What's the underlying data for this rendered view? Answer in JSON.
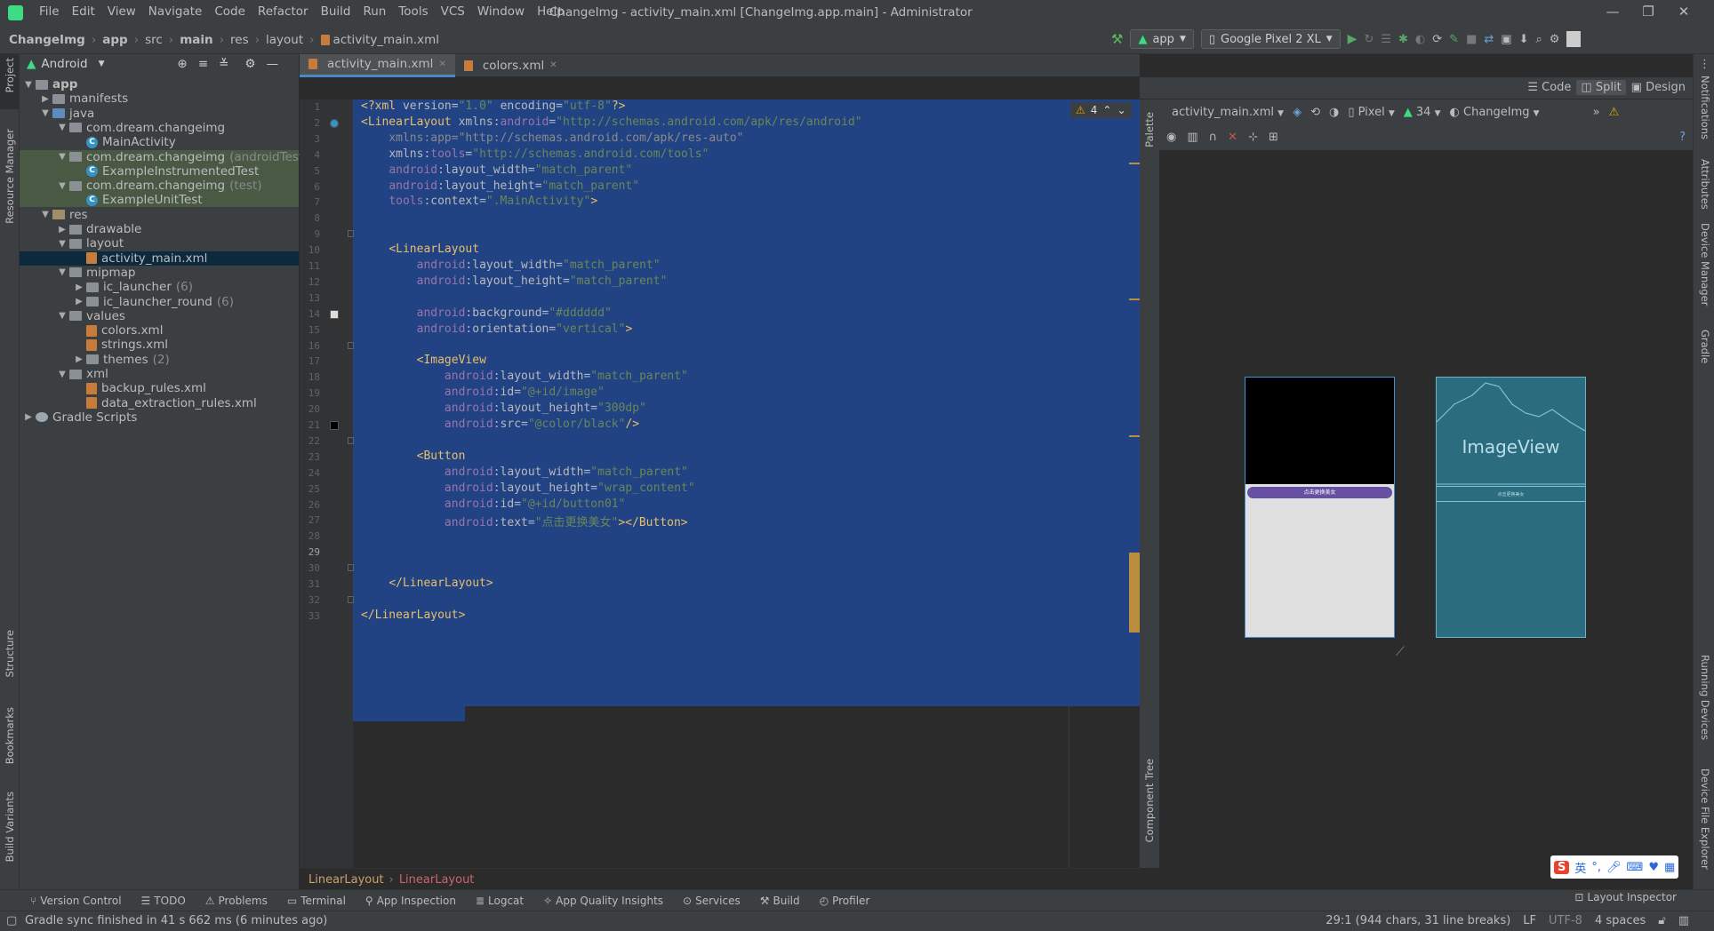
{
  "menu": {
    "items": [
      "File",
      "Edit",
      "View",
      "Navigate",
      "Code",
      "Refactor",
      "Build",
      "Run",
      "Tools",
      "VCS",
      "Window",
      "Help"
    ]
  },
  "window": {
    "title": "ChangeImg - activity_main.xml [ChangeImg.app.main] - Administrator"
  },
  "breadcrumb": {
    "items": [
      "ChangeImg",
      "app",
      "src",
      "main",
      "res",
      "layout",
      "activity_main.xml"
    ]
  },
  "toolbar": {
    "run_config": "app",
    "device": "Google Pixel 2 XL"
  },
  "project": {
    "view_label": "Android",
    "tree": [
      {
        "label": "app",
        "depth": 0,
        "arrow": "▼",
        "icon": "folder",
        "bold": true
      },
      {
        "label": "manifests",
        "depth": 1,
        "arrow": "▶",
        "icon": "folder"
      },
      {
        "label": "java",
        "depth": 1,
        "arrow": "▼",
        "icon": "jfolder"
      },
      {
        "label": "com.dream.changeimg",
        "depth": 2,
        "arrow": "▼",
        "icon": "folder"
      },
      {
        "label": "MainActivity",
        "depth": 3,
        "arrow": "",
        "icon": "class"
      },
      {
        "label": "com.dream.changeimg",
        "suffix": "(androidTest)",
        "depth": 2,
        "arrow": "▼",
        "icon": "folder",
        "hl": true
      },
      {
        "label": "ExampleInstrumentedTest",
        "depth": 3,
        "arrow": "",
        "icon": "class",
        "hl": true
      },
      {
        "label": "com.dream.changeimg",
        "suffix": "(test)",
        "depth": 2,
        "arrow": "▼",
        "icon": "folder",
        "hl": true
      },
      {
        "label": "ExampleUnitTest",
        "depth": 3,
        "arrow": "",
        "icon": "class",
        "hl": true
      },
      {
        "label": "res",
        "depth": 1,
        "arrow": "▼",
        "icon": "rfolder"
      },
      {
        "label": "drawable",
        "depth": 2,
        "arrow": "▶",
        "icon": "folder"
      },
      {
        "label": "layout",
        "depth": 2,
        "arrow": "▼",
        "icon": "folder"
      },
      {
        "label": "activity_main.xml",
        "depth": 3,
        "arrow": "",
        "icon": "xml",
        "selected": true
      },
      {
        "label": "mipmap",
        "depth": 2,
        "arrow": "▼",
        "icon": "folder"
      },
      {
        "label": "ic_launcher",
        "suffix": "(6)",
        "depth": 3,
        "arrow": "▶",
        "icon": "folder"
      },
      {
        "label": "ic_launcher_round",
        "suffix": "(6)",
        "depth": 3,
        "arrow": "▶",
        "icon": "folder"
      },
      {
        "label": "values",
        "depth": 2,
        "arrow": "▼",
        "icon": "folder"
      },
      {
        "label": "colors.xml",
        "depth": 3,
        "arrow": "",
        "icon": "xml"
      },
      {
        "label": "strings.xml",
        "depth": 3,
        "arrow": "",
        "icon": "xml"
      },
      {
        "label": "themes",
        "suffix": "(2)",
        "depth": 3,
        "arrow": "▶",
        "icon": "folder"
      },
      {
        "label": "xml",
        "depth": 2,
        "arrow": "▼",
        "icon": "folder"
      },
      {
        "label": "backup_rules.xml",
        "depth": 3,
        "arrow": "",
        "icon": "xml"
      },
      {
        "label": "data_extraction_rules.xml",
        "depth": 3,
        "arrow": "",
        "icon": "xml"
      },
      {
        "label": "Gradle Scripts",
        "depth": 0,
        "arrow": "▶",
        "icon": "gradle"
      }
    ]
  },
  "tabs": [
    {
      "label": "activity_main.xml",
      "active": true
    },
    {
      "label": "colors.xml",
      "active": false
    }
  ],
  "editor": {
    "warning_count": "4",
    "lines": [
      [
        [
          "tg",
          "<?xml "
        ],
        [
          "at",
          "version="
        ],
        [
          "av",
          "\"1.0\" "
        ],
        [
          "at",
          "encoding="
        ],
        [
          "av",
          "\"utf-8\""
        ],
        [
          "tg",
          "?>"
        ]
      ],
      [
        [
          "tg",
          "<LinearLayout "
        ],
        [
          "at",
          "xmlns:"
        ],
        [
          "an",
          "android"
        ],
        [
          "pl",
          "="
        ],
        [
          "av",
          "\"http://schemas.android.com/apk/res/android\""
        ]
      ],
      [
        [
          "pl",
          "    "
        ],
        [
          "dim",
          "xmlns:app=\"http://schemas.android.com/apk/res-auto\""
        ]
      ],
      [
        [
          "pl",
          "    "
        ],
        [
          "at",
          "xmlns:"
        ],
        [
          "an",
          "tools"
        ],
        [
          "pl",
          "="
        ],
        [
          "av",
          "\"http://schemas.android.com/tools\""
        ]
      ],
      [
        [
          "pl",
          "    "
        ],
        [
          "an",
          "android"
        ],
        [
          "pl",
          ":"
        ],
        [
          "at",
          "layout_width"
        ],
        [
          "pl",
          "="
        ],
        [
          "av",
          "\"match_parent\""
        ]
      ],
      [
        [
          "pl",
          "    "
        ],
        [
          "an",
          "android"
        ],
        [
          "pl",
          ":"
        ],
        [
          "at",
          "layout_height"
        ],
        [
          "pl",
          "="
        ],
        [
          "av",
          "\"match_parent\""
        ]
      ],
      [
        [
          "pl",
          "    "
        ],
        [
          "an",
          "tools"
        ],
        [
          "pl",
          ":"
        ],
        [
          "at",
          "context"
        ],
        [
          "pl",
          "="
        ],
        [
          "av",
          "\".MainActivity\""
        ],
        [
          "tg",
          ">"
        ]
      ],
      [],
      [],
      [
        [
          "pl",
          "    "
        ],
        [
          "tg",
          "<LinearLayout"
        ]
      ],
      [
        [
          "pl",
          "        "
        ],
        [
          "an",
          "android"
        ],
        [
          "pl",
          ":"
        ],
        [
          "at",
          "layout_width"
        ],
        [
          "pl",
          "="
        ],
        [
          "av",
          "\"match_parent\""
        ]
      ],
      [
        [
          "pl",
          "        "
        ],
        [
          "an",
          "android"
        ],
        [
          "pl",
          ":"
        ],
        [
          "at",
          "layout_height"
        ],
        [
          "pl",
          "="
        ],
        [
          "av",
          "\"match_parent\""
        ]
      ],
      [],
      [
        [
          "pl",
          "        "
        ],
        [
          "an",
          "android"
        ],
        [
          "pl",
          ":"
        ],
        [
          "at",
          "background"
        ],
        [
          "pl",
          "="
        ],
        [
          "av",
          "\"#dddddd\""
        ]
      ],
      [
        [
          "pl",
          "        "
        ],
        [
          "an",
          "android"
        ],
        [
          "pl",
          ":"
        ],
        [
          "at",
          "orientation"
        ],
        [
          "pl",
          "="
        ],
        [
          "av",
          "\"vertical\""
        ],
        [
          "tg",
          ">"
        ]
      ],
      [],
      [
        [
          "pl",
          "        "
        ],
        [
          "tg",
          "<ImageView"
        ]
      ],
      [
        [
          "pl",
          "            "
        ],
        [
          "an",
          "android"
        ],
        [
          "pl",
          ":"
        ],
        [
          "at",
          "layout_width"
        ],
        [
          "pl",
          "="
        ],
        [
          "av",
          "\"match_parent\""
        ]
      ],
      [
        [
          "pl",
          "            "
        ],
        [
          "an",
          "android"
        ],
        [
          "pl",
          ":"
        ],
        [
          "at",
          "id"
        ],
        [
          "pl",
          "="
        ],
        [
          "av",
          "\"@+id/image\""
        ]
      ],
      [
        [
          "pl",
          "            "
        ],
        [
          "an",
          "android"
        ],
        [
          "pl",
          ":"
        ],
        [
          "at",
          "layout_height"
        ],
        [
          "pl",
          "="
        ],
        [
          "av",
          "\"300dp\""
        ]
      ],
      [
        [
          "pl",
          "            "
        ],
        [
          "an",
          "android"
        ],
        [
          "pl",
          ":"
        ],
        [
          "at",
          "src"
        ],
        [
          "pl",
          "="
        ],
        [
          "av",
          "\"@color/black\""
        ],
        [
          "tg",
          "/>"
        ]
      ],
      [],
      [
        [
          "pl",
          "        "
        ],
        [
          "tg",
          "<Button"
        ]
      ],
      [
        [
          "pl",
          "            "
        ],
        [
          "an",
          "android"
        ],
        [
          "pl",
          ":"
        ],
        [
          "at",
          "layout_width"
        ],
        [
          "pl",
          "="
        ],
        [
          "av",
          "\"match_parent\""
        ]
      ],
      [
        [
          "pl",
          "            "
        ],
        [
          "an",
          "android"
        ],
        [
          "pl",
          ":"
        ],
        [
          "at",
          "layout_height"
        ],
        [
          "pl",
          "="
        ],
        [
          "av",
          "\"wrap_content\""
        ]
      ],
      [
        [
          "pl",
          "            "
        ],
        [
          "an",
          "android"
        ],
        [
          "pl",
          ":"
        ],
        [
          "at",
          "id"
        ],
        [
          "pl",
          "="
        ],
        [
          "av",
          "\"@+id/button01\""
        ]
      ],
      [
        [
          "pl",
          "            "
        ],
        [
          "an",
          "android"
        ],
        [
          "pl",
          ":"
        ],
        [
          "at",
          "text"
        ],
        [
          "pl",
          "="
        ],
        [
          "av",
          "\"点击更换美女\""
        ],
        [
          "tg",
          "></Button>"
        ]
      ],
      [],
      [],
      [],
      [
        [
          "pl",
          "    "
        ],
        [
          "tg",
          "</LinearLayout>"
        ]
      ],
      [],
      [
        [
          "tg",
          "</LinearLayout>"
        ]
      ]
    ]
  },
  "editor_breadcrumb": [
    "LinearLayout",
    "LinearLayout"
  ],
  "design": {
    "view_modes": [
      "Code",
      "Split",
      "Design"
    ],
    "file": "activity_main.xml",
    "device": "Pixel",
    "api": "34",
    "theme": "ChangeImg",
    "blueprint_label": "ImageView",
    "button_text": "点击更换美女"
  },
  "left_strip": [
    "Project",
    "Resource Manager",
    "Structure",
    "Bookmarks",
    "Build Variants"
  ],
  "right_strip": [
    "Notifications",
    "Attributes",
    "Device Manager",
    "Gradle",
    "Running Devices",
    "Device File Explorer"
  ],
  "design_strip": [
    "Palette",
    "Component Tree"
  ],
  "bottom_tabs": [
    "Version Control",
    "TODO",
    "Problems",
    "Terminal",
    "App Inspection",
    "Logcat",
    "App Quality Insights",
    "Services",
    "Build",
    "Profiler"
  ],
  "layout_inspector": "Layout Inspector",
  "status": {
    "message": "Gradle sync finished in 41 s 662 ms (6 minutes ago)",
    "position": "29:1 (944 chars, 31 line breaks)",
    "line_sep": "LF",
    "encoding": "UTF-8",
    "indent": "4 spaces"
  },
  "ime": {
    "label": "英"
  },
  "colors": {
    "selection": "#214283",
    "accent": "#4a88c7",
    "button_purple": "#6750a4",
    "blueprint": "#2b6c7e"
  }
}
